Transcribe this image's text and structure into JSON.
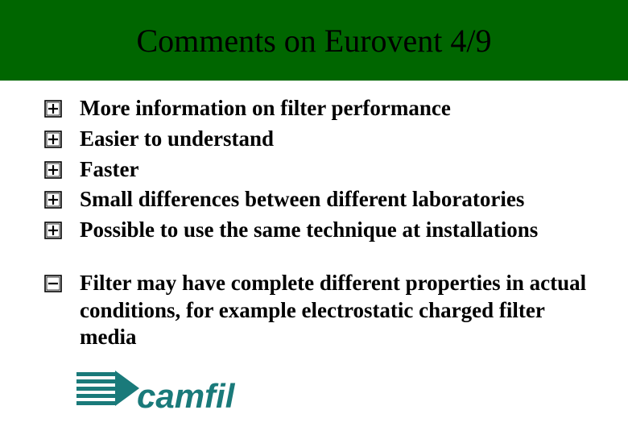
{
  "title": "Comments on Eurovent 4/9",
  "positives": [
    "More information on filter performance",
    "Easier to understand",
    "Faster",
    "Small differences between different laboratories",
    "Possible to use the same technique at installations"
  ],
  "negatives": [
    "Filter may have complete different properties in actual conditions, for example electrostatic charged filter media"
  ],
  "logo_text": "camfil",
  "colors": {
    "header_bg": "#006600",
    "logo_teal": "#1a7a7a"
  }
}
